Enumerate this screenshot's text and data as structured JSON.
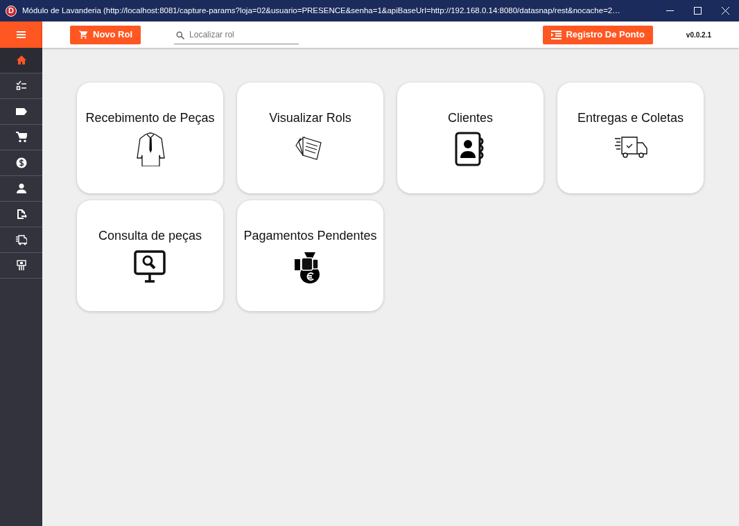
{
  "window": {
    "app_letter": "D",
    "title": "Módulo de Lavanderia (http://localhost:8081/capture-params?loja=02&usuario=PRESENCE&senha=1&apiBaseUrl=http://192.168.0.14:8080/datasnap/rest&nocache=2…"
  },
  "toolbar": {
    "new_button": "Novo Rol",
    "search": {
      "placeholder": "Localizar rol"
    },
    "clock_button": "Registro De Ponto",
    "version": "v0.0.2.1"
  },
  "sidebar": {
    "items": [
      {
        "kind": "home",
        "selected": true
      },
      {
        "kind": "checklist",
        "selected": false
      },
      {
        "kind": "tag",
        "selected": false
      },
      {
        "kind": "cart",
        "selected": false
      },
      {
        "kind": "money",
        "selected": false
      },
      {
        "kind": "person",
        "selected": false
      },
      {
        "kind": "export",
        "selected": false
      },
      {
        "kind": "truck",
        "selected": false
      },
      {
        "kind": "register",
        "selected": false
      }
    ]
  },
  "tiles": [
    {
      "kind": "shirt",
      "title": "Recebimento de Peças"
    },
    {
      "kind": "papers",
      "title": "Visualizar Rols"
    },
    {
      "kind": "contacts",
      "title": "Clientes"
    },
    {
      "kind": "truck",
      "title": "Entregas e Coletas"
    },
    {
      "kind": "monitor",
      "title": "Consulta de peças"
    },
    {
      "kind": "moneybag",
      "title": "Pagamentos Pendentes"
    }
  ]
}
